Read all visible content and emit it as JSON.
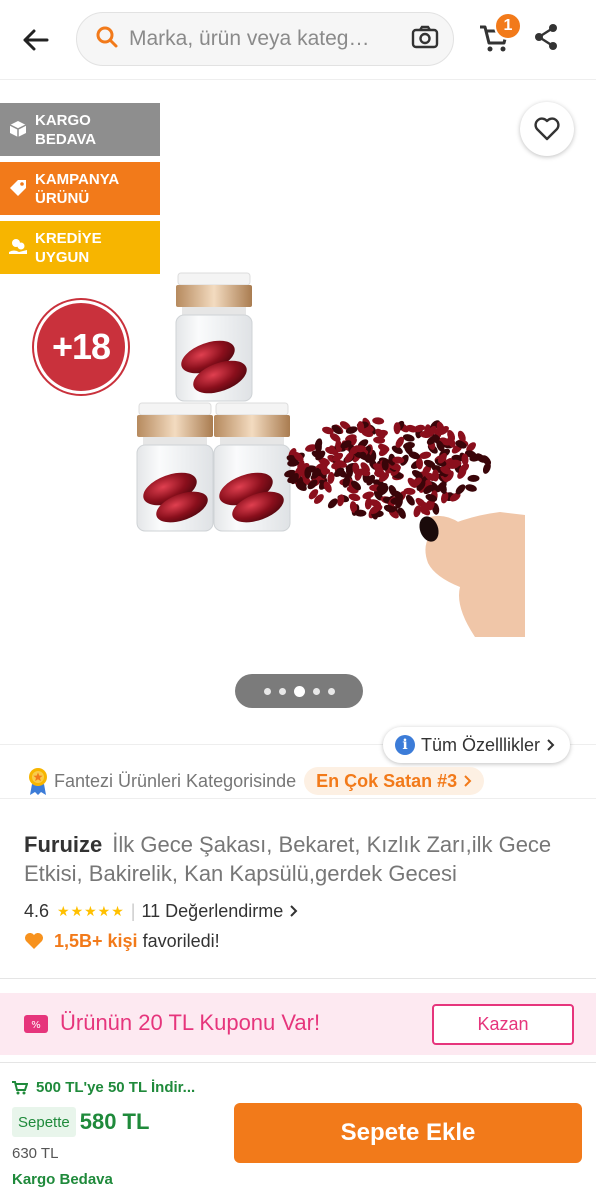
{
  "header": {
    "search_placeholder": "Marka, ürün veya kateg…",
    "cart_count": "1"
  },
  "badges": {
    "free_cargo": "KARGO BEDAVA",
    "campaign": "KAMPANYA ÜRÜNÜ",
    "credit": "KREDİYE UYGUN",
    "age": "+18"
  },
  "gallery": {
    "image_count": 5,
    "active_index": 2
  },
  "info": {
    "all_features": "Tüm Özelllikler",
    "category_text": "Fantezi Ürünleri Kategorisinde",
    "best_seller": "En Çok Satan #3"
  },
  "product": {
    "brand": "Furuize",
    "name": "İlk Gece Şakası, Bekaret, Kızlık Zarı,ilk Gece Etkisi, Bakirelik, Kan Kapsülü,gerdek Gecesi",
    "rating": "4.6",
    "rating_value": 4.6,
    "review_count": "11 Değerlendirme",
    "fav_count": "1,5B+ kişi",
    "fav_suffix": "favoriledi!"
  },
  "coupon": {
    "text": "Ürünün 20 TL Kuponu Var!",
    "button": "Kazan"
  },
  "bottom": {
    "promo": "500 TL'ye 50 TL İndir...",
    "basket_label": "Sepette",
    "basket_price": "580 TL",
    "old_price": "630 TL",
    "free_shipping": "Kargo Bedava",
    "add_to_cart": "Sepete Ekle"
  },
  "colors": {
    "brand_orange": "#f27a1a",
    "green": "#1f8a3b",
    "pink": "#e6357c"
  }
}
